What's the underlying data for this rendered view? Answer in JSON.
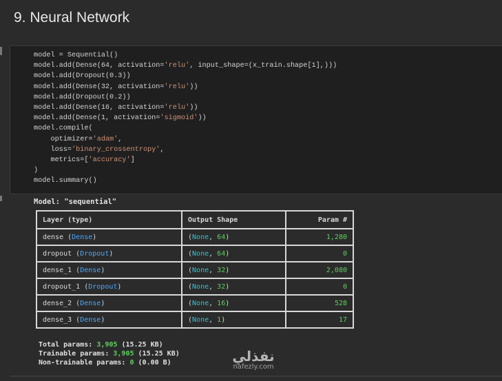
{
  "heading": "9. Neural Network",
  "code_lines": [
    [
      {
        "t": "model = Sequential()"
      }
    ],
    [
      {
        "t": "model.add(Dense(64, activation="
      },
      {
        "t": "'relu'",
        "c": "s"
      },
      {
        "t": ", input_shape=(x_train.shape[1],)))"
      }
    ],
    [
      {
        "t": "model.add(Dropout(0.3))"
      }
    ],
    [
      {
        "t": "model.add(Dense(32, activation="
      },
      {
        "t": "'relu'",
        "c": "s"
      },
      {
        "t": "))"
      }
    ],
    [
      {
        "t": "model.add(Dropout(0.2))"
      }
    ],
    [
      {
        "t": "model.add(Dense(16, activation="
      },
      {
        "t": "'relu'",
        "c": "s"
      },
      {
        "t": "))"
      }
    ],
    [
      {
        "t": "model.add(Dense(1, activation="
      },
      {
        "t": "'sigmoid'",
        "c": "s"
      },
      {
        "t": "))"
      }
    ],
    [
      {
        "t": "model.compile("
      }
    ],
    [
      {
        "t": "    optimizer="
      },
      {
        "t": "'adam'",
        "c": "s"
      },
      {
        "t": ","
      }
    ],
    [
      {
        "t": "    loss="
      },
      {
        "t": "'binary_crossentropy'",
        "c": "s"
      },
      {
        "t": ","
      }
    ],
    [
      {
        "t": "    metrics=["
      },
      {
        "t": "'accuracy'",
        "c": "s"
      },
      {
        "t": "]"
      }
    ],
    [
      {
        "t": ")"
      }
    ],
    [
      {
        "t": "model.summary()"
      }
    ]
  ],
  "output": {
    "model_title": "Model: \"sequential\"",
    "headers": {
      "layer": "Layer (type)",
      "shape": "Output Shape",
      "params": "Param #"
    },
    "rows": [
      {
        "name": "dense",
        "type": "Dense",
        "shape_none": "None",
        "shape_dim": "64",
        "params": "1,280"
      },
      {
        "name": "dropout",
        "type": "Dropout",
        "shape_none": "None",
        "shape_dim": "64",
        "params": "0"
      },
      {
        "name": "dense_1",
        "type": "Dense",
        "shape_none": "None",
        "shape_dim": "32",
        "params": "2,080"
      },
      {
        "name": "dropout_1",
        "type": "Dropout",
        "shape_none": "None",
        "shape_dim": "32",
        "params": "0"
      },
      {
        "name": "dense_2",
        "type": "Dense",
        "shape_none": "None",
        "shape_dim": "16",
        "params": "528"
      },
      {
        "name": "dense_3",
        "type": "Dense",
        "shape_none": "None",
        "shape_dim": "1",
        "params": "17"
      }
    ],
    "totals": {
      "total_label": "Total params:",
      "total_value": "3,905",
      "total_size": "(15.25 KB)",
      "trainable_label": "Trainable params:",
      "trainable_value": "3,905",
      "trainable_size": "(15.25 KB)",
      "non_trainable_label": "Non-trainable params:",
      "non_trainable_value": "0",
      "non_trainable_size": "(0.00 B)"
    }
  },
  "watermark": {
    "logo": "نفذلي",
    "url": "nafezly.com"
  }
}
